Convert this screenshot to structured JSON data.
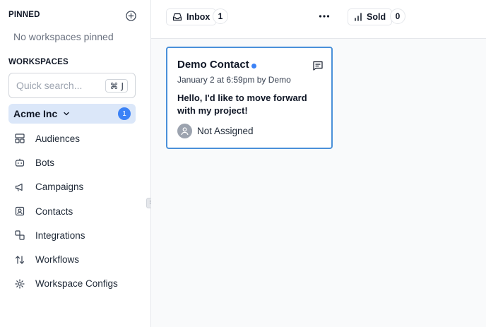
{
  "sidebar": {
    "pinned_title": "PINNED",
    "no_pinned_text": "No workspaces pinned",
    "workspaces_title": "WORKSPACES",
    "search_placeholder": "Quick search...",
    "search_shortcut": {
      "symbol": "⌘",
      "key": "J"
    },
    "workspace": {
      "name": "Acme Inc",
      "badge": "1"
    },
    "nav_items": [
      {
        "label": "Audiences",
        "icon": "layout-icon"
      },
      {
        "label": "Bots",
        "icon": "bot-icon"
      },
      {
        "label": "Campaigns",
        "icon": "megaphone-icon"
      },
      {
        "label": "Contacts",
        "icon": "contact-card-icon"
      },
      {
        "label": "Integrations",
        "icon": "integrations-icon"
      },
      {
        "label": "Workflows",
        "icon": "arrows-up-down-icon"
      },
      {
        "label": "Workspace Configs",
        "icon": "gear-icon"
      }
    ]
  },
  "columns": [
    {
      "label": "Inbox",
      "icon": "inbox-icon",
      "count": "1"
    },
    {
      "label": "Sold",
      "icon": "signal-bars-icon",
      "count": "0"
    }
  ],
  "card": {
    "name": "Demo Contact",
    "meta": "January 2 at 6:59pm by Demo",
    "message": "Hello, I'd like to move forward with my project!",
    "assignee": "Not Assigned"
  },
  "colors": {
    "accent": "#3b82f6",
    "card_border": "#4a90d9",
    "workspace_highlight": "#dbe7f9"
  }
}
